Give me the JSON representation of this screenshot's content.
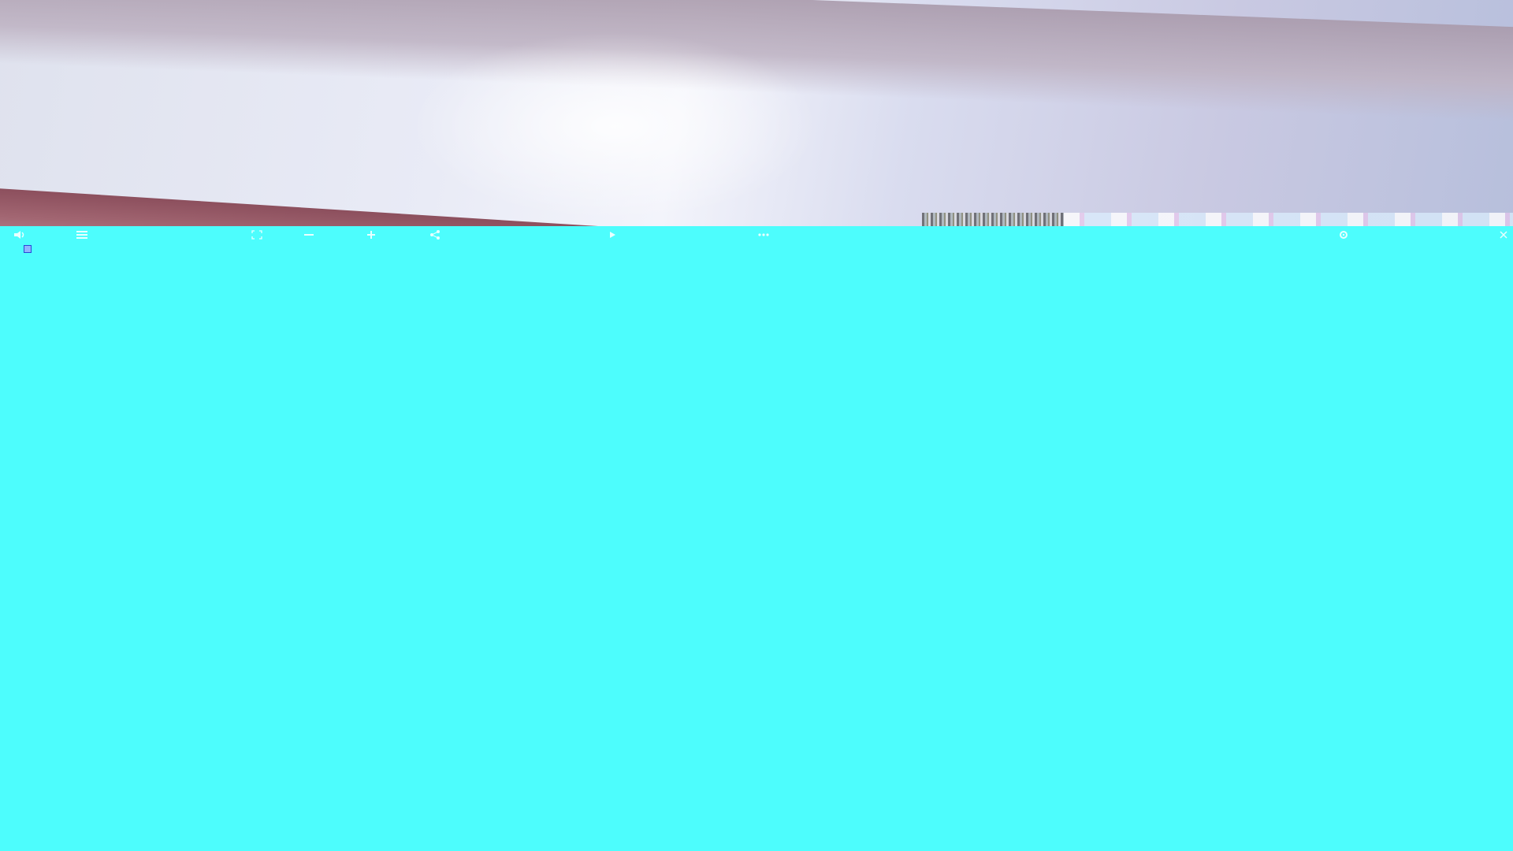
{
  "window": {
    "background_color": "#4dfdfd",
    "accent_color": "#2a47d6"
  },
  "toolbar": {
    "items": [
      {
        "icon": "speaker-icon"
      },
      {
        "icon": "menu-icon"
      },
      {
        "icon": "expand-icon"
      },
      {
        "icon": "minus-icon"
      },
      {
        "icon": "plus-icon"
      },
      {
        "icon": "share-icon"
      },
      {
        "icon": "play-icon"
      },
      {
        "icon": "dots-icon"
      },
      {
        "icon": "settings-icon"
      },
      {
        "icon": "close-icon"
      }
    ]
  }
}
